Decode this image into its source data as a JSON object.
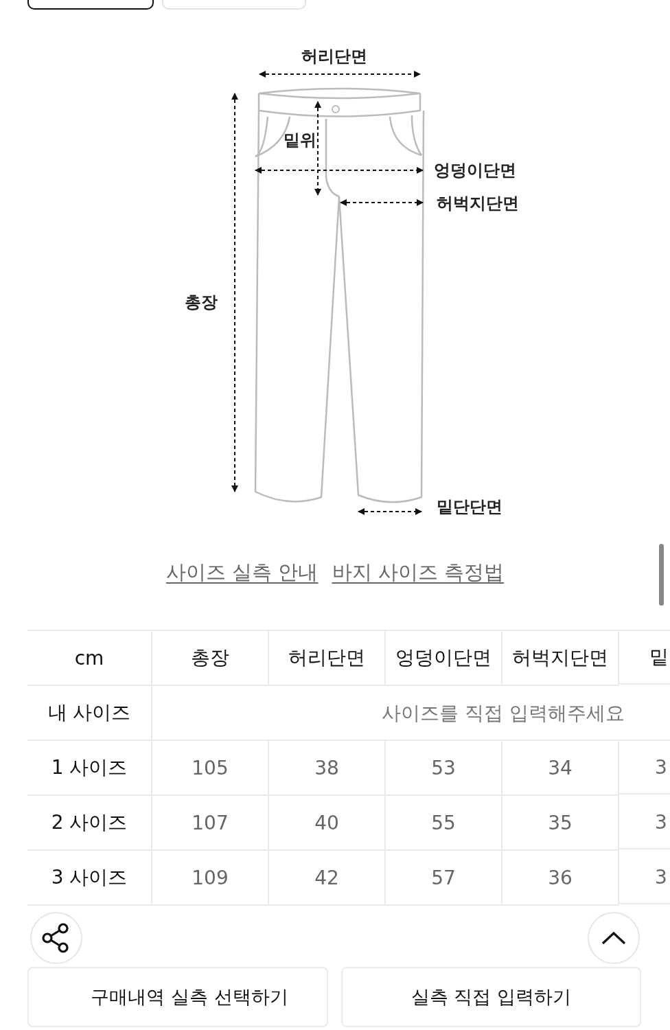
{
  "tabs": [
    {
      "selected": true
    },
    {
      "selected": false
    }
  ],
  "diagram": {
    "labels": [
      {
        "kind": "waist",
        "text": "허리단면"
      },
      {
        "kind": "rise",
        "text": "밑위"
      },
      {
        "kind": "hip",
        "text": "엉덩이단면"
      },
      {
        "kind": "thigh",
        "text": "허벅지단면"
      },
      {
        "kind": "length",
        "text": "총장"
      },
      {
        "kind": "hem",
        "text": "밑단단면"
      }
    ]
  },
  "links": [
    "사이즈 실측 안내",
    "바지 사이즈 측정법"
  ],
  "table": {
    "columns": [
      "cm",
      "총장",
      "허리단면",
      "엉덩이단면",
      "허벅지단면",
      "밑"
    ],
    "my_size": {
      "label": "내 사이즈",
      "placeholder": "사이즈를 직접 입력해주세요"
    },
    "rows": [
      {
        "label": "1 사이즈",
        "values": [
          "105",
          "38",
          "53",
          "34",
          "3"
        ]
      },
      {
        "label": "2 사이즈",
        "values": [
          "107",
          "40",
          "55",
          "35",
          "3"
        ]
      },
      {
        "label": "3 사이즈",
        "values": [
          "109",
          "42",
          "57",
          "36",
          "3"
        ]
      }
    ]
  },
  "buttons": [
    "구매내역 실측 선택하기",
    "실측 직접 입력하기"
  ]
}
